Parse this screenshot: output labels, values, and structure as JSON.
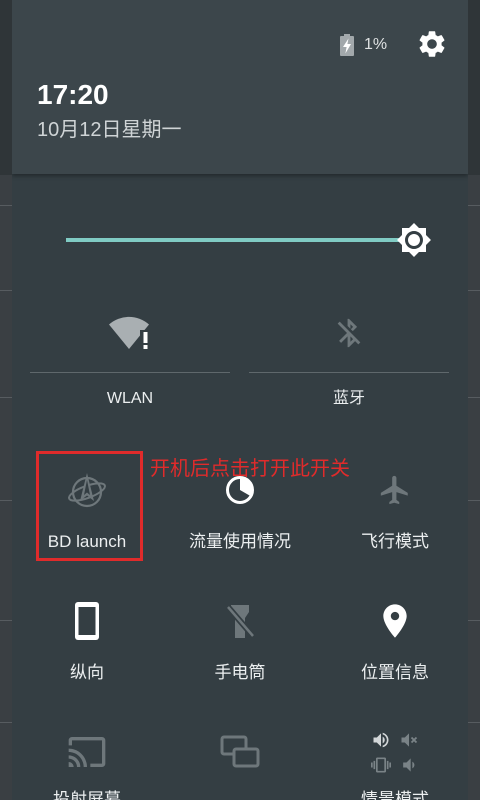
{
  "colors": {
    "panel_bg": "#343e43",
    "header_bg": "#3c464b",
    "accent": "#80cbc4",
    "annotation": "#e02b2b",
    "icon_on": "#ffffff",
    "icon_off": "#6e777b"
  },
  "status": {
    "battery_icon": "battery-charging-icon",
    "battery_level": "1%",
    "settings_icon": "gear-icon"
  },
  "header": {
    "time": "17:20",
    "date": "10月12日星期一"
  },
  "brightness": {
    "icon": "brightness-high-icon",
    "level": 1.0
  },
  "large_tiles": [
    {
      "label": "WLAN",
      "icon": "wifi-no-internet-icon",
      "enabled": true
    },
    {
      "label": "蓝牙",
      "icon": "bluetooth-disabled-icon",
      "enabled": false
    }
  ],
  "tiles": [
    {
      "label": "BD launch",
      "icon": "bd-launch-globe-icon",
      "enabled": false
    },
    {
      "label": "流量使用情况",
      "icon": "data-usage-icon",
      "enabled": true
    },
    {
      "label": "飞行模式",
      "icon": "airplane-icon",
      "enabled": false
    },
    {
      "label": "纵向",
      "icon": "portrait-phone-icon",
      "enabled": true
    },
    {
      "label": "手电筒",
      "icon": "flashlight-off-icon",
      "enabled": false
    },
    {
      "label": "位置信息",
      "icon": "location-pin-icon",
      "enabled": true
    },
    {
      "label": "投射屏幕",
      "icon": "cast-icon",
      "enabled": false
    },
    {
      "icon": "overlapping-windows-icon",
      "enabled": false
    },
    {
      "label": "情景模式",
      "icon": "sound-profile-icon",
      "enabled": true
    }
  ],
  "annotation": {
    "text": "开机后点击打开此开关"
  }
}
